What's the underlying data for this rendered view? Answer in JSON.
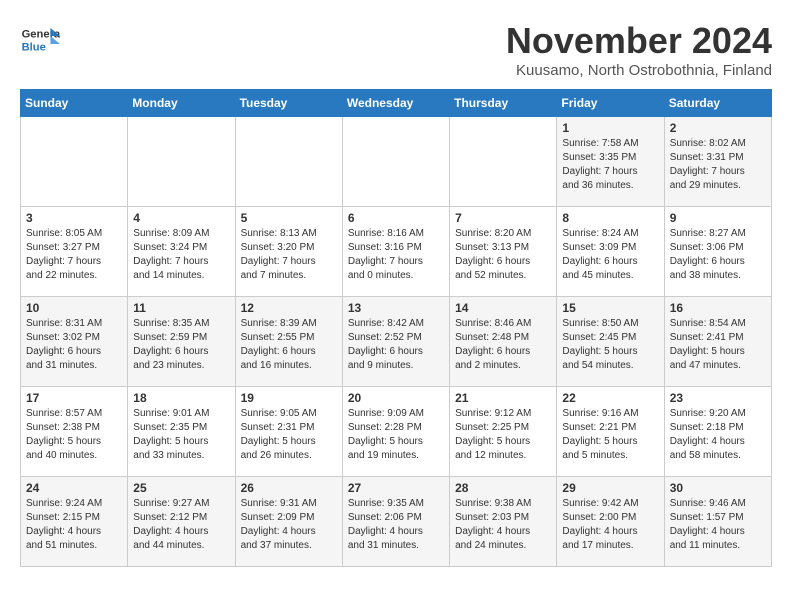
{
  "header": {
    "logo_line1": "General",
    "logo_line2": "Blue",
    "month": "November 2024",
    "location": "Kuusamo, North Ostrobothnia, Finland"
  },
  "columns": [
    "Sunday",
    "Monday",
    "Tuesday",
    "Wednesday",
    "Thursday",
    "Friday",
    "Saturday"
  ],
  "weeks": [
    [
      {
        "day": "",
        "info": ""
      },
      {
        "day": "",
        "info": ""
      },
      {
        "day": "",
        "info": ""
      },
      {
        "day": "",
        "info": ""
      },
      {
        "day": "",
        "info": ""
      },
      {
        "day": "1",
        "info": "Sunrise: 7:58 AM\nSunset: 3:35 PM\nDaylight: 7 hours\nand 36 minutes."
      },
      {
        "day": "2",
        "info": "Sunrise: 8:02 AM\nSunset: 3:31 PM\nDaylight: 7 hours\nand 29 minutes."
      }
    ],
    [
      {
        "day": "3",
        "info": "Sunrise: 8:05 AM\nSunset: 3:27 PM\nDaylight: 7 hours\nand 22 minutes."
      },
      {
        "day": "4",
        "info": "Sunrise: 8:09 AM\nSunset: 3:24 PM\nDaylight: 7 hours\nand 14 minutes."
      },
      {
        "day": "5",
        "info": "Sunrise: 8:13 AM\nSunset: 3:20 PM\nDaylight: 7 hours\nand 7 minutes."
      },
      {
        "day": "6",
        "info": "Sunrise: 8:16 AM\nSunset: 3:16 PM\nDaylight: 7 hours\nand 0 minutes."
      },
      {
        "day": "7",
        "info": "Sunrise: 8:20 AM\nSunset: 3:13 PM\nDaylight: 6 hours\nand 52 minutes."
      },
      {
        "day": "8",
        "info": "Sunrise: 8:24 AM\nSunset: 3:09 PM\nDaylight: 6 hours\nand 45 minutes."
      },
      {
        "day": "9",
        "info": "Sunrise: 8:27 AM\nSunset: 3:06 PM\nDaylight: 6 hours\nand 38 minutes."
      }
    ],
    [
      {
        "day": "10",
        "info": "Sunrise: 8:31 AM\nSunset: 3:02 PM\nDaylight: 6 hours\nand 31 minutes."
      },
      {
        "day": "11",
        "info": "Sunrise: 8:35 AM\nSunset: 2:59 PM\nDaylight: 6 hours\nand 23 minutes."
      },
      {
        "day": "12",
        "info": "Sunrise: 8:39 AM\nSunset: 2:55 PM\nDaylight: 6 hours\nand 16 minutes."
      },
      {
        "day": "13",
        "info": "Sunrise: 8:42 AM\nSunset: 2:52 PM\nDaylight: 6 hours\nand 9 minutes."
      },
      {
        "day": "14",
        "info": "Sunrise: 8:46 AM\nSunset: 2:48 PM\nDaylight: 6 hours\nand 2 minutes."
      },
      {
        "day": "15",
        "info": "Sunrise: 8:50 AM\nSunset: 2:45 PM\nDaylight: 5 hours\nand 54 minutes."
      },
      {
        "day": "16",
        "info": "Sunrise: 8:54 AM\nSunset: 2:41 PM\nDaylight: 5 hours\nand 47 minutes."
      }
    ],
    [
      {
        "day": "17",
        "info": "Sunrise: 8:57 AM\nSunset: 2:38 PM\nDaylight: 5 hours\nand 40 minutes."
      },
      {
        "day": "18",
        "info": "Sunrise: 9:01 AM\nSunset: 2:35 PM\nDaylight: 5 hours\nand 33 minutes."
      },
      {
        "day": "19",
        "info": "Sunrise: 9:05 AM\nSunset: 2:31 PM\nDaylight: 5 hours\nand 26 minutes."
      },
      {
        "day": "20",
        "info": "Sunrise: 9:09 AM\nSunset: 2:28 PM\nDaylight: 5 hours\nand 19 minutes."
      },
      {
        "day": "21",
        "info": "Sunrise: 9:12 AM\nSunset: 2:25 PM\nDaylight: 5 hours\nand 12 minutes."
      },
      {
        "day": "22",
        "info": "Sunrise: 9:16 AM\nSunset: 2:21 PM\nDaylight: 5 hours\nand 5 minutes."
      },
      {
        "day": "23",
        "info": "Sunrise: 9:20 AM\nSunset: 2:18 PM\nDaylight: 4 hours\nand 58 minutes."
      }
    ],
    [
      {
        "day": "24",
        "info": "Sunrise: 9:24 AM\nSunset: 2:15 PM\nDaylight: 4 hours\nand 51 minutes."
      },
      {
        "day": "25",
        "info": "Sunrise: 9:27 AM\nSunset: 2:12 PM\nDaylight: 4 hours\nand 44 minutes."
      },
      {
        "day": "26",
        "info": "Sunrise: 9:31 AM\nSunset: 2:09 PM\nDaylight: 4 hours\nand 37 minutes."
      },
      {
        "day": "27",
        "info": "Sunrise: 9:35 AM\nSunset: 2:06 PM\nDaylight: 4 hours\nand 31 minutes."
      },
      {
        "day": "28",
        "info": "Sunrise: 9:38 AM\nSunset: 2:03 PM\nDaylight: 4 hours\nand 24 minutes."
      },
      {
        "day": "29",
        "info": "Sunrise: 9:42 AM\nSunset: 2:00 PM\nDaylight: 4 hours\nand 17 minutes."
      },
      {
        "day": "30",
        "info": "Sunrise: 9:46 AM\nSunset: 1:57 PM\nDaylight: 4 hours\nand 11 minutes."
      }
    ]
  ]
}
